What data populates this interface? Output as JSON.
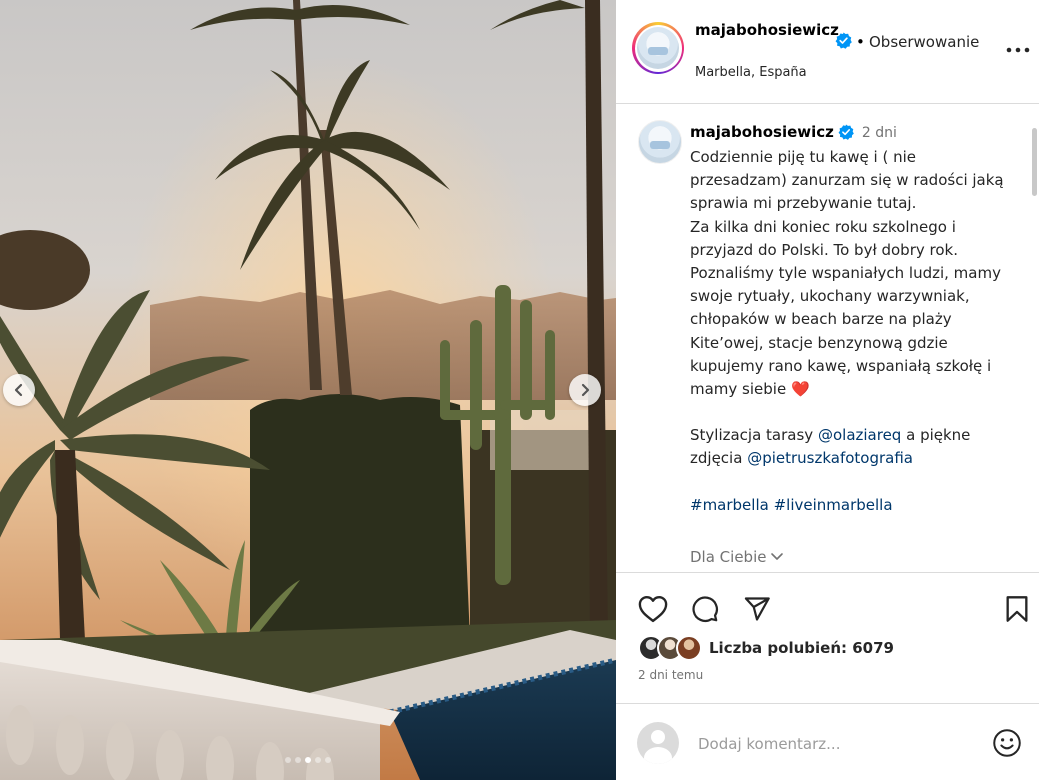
{
  "post": {
    "username": "majabohosiewicz",
    "follow_label": "Obserwowanie",
    "location": "Marbella, España",
    "bullet": "•"
  },
  "caption": {
    "username": "majabohosiewicz",
    "time_ago": "2 dni",
    "para1": "Codziennie piję tu kawę i ( nie przesadzam) zanurzam się w radości jaką sprawia mi przebywanie tutaj.",
    "para2": "Za kilka dni koniec roku szkolnego i przyjazd do Polski. To był dobry rok. Poznaliśmy tyle wspaniałych ludzi, mamy swoje rytuały, ukochany warzywniak, chłopaków w beach barze na plaży Kite’owej, stacje benzynową gdzie kupujemy rano kawę, wspaniałą szkołę i mamy siebie",
    "heart_emoji": "❤️",
    "line3_prefix": "Stylizacja tarasy",
    "mention1": "@olaziareq",
    "line3_middle": "a piękne zdjęcia",
    "mention2": "@pietruszkafotografia",
    "hashtag1": "#marbella",
    "hashtag2": "#liveinmarbella",
    "for_you_label": "Dla Ciebie"
  },
  "actions": {
    "likes_label": "Liczba polubień: 6079",
    "date": "2 dni temu"
  },
  "composer": {
    "placeholder": "Dodaj komentarz..."
  },
  "carousel": {
    "total": 5,
    "active_index": 2
  },
  "icons": {
    "verified": "verified-badge-icon",
    "more": "more-options-icon",
    "like": "heart-icon",
    "comment": "comment-bubble-icon",
    "share": "paper-plane-icon",
    "save": "bookmark-icon",
    "emoji": "smiley-icon",
    "prev": "chevron-left-icon",
    "next": "chevron-right-icon"
  },
  "colors": {
    "link": "#00376b",
    "verified": "#0095f6",
    "muted": "#737373",
    "border": "#dbdbdb",
    "heart": "#e0245e"
  }
}
